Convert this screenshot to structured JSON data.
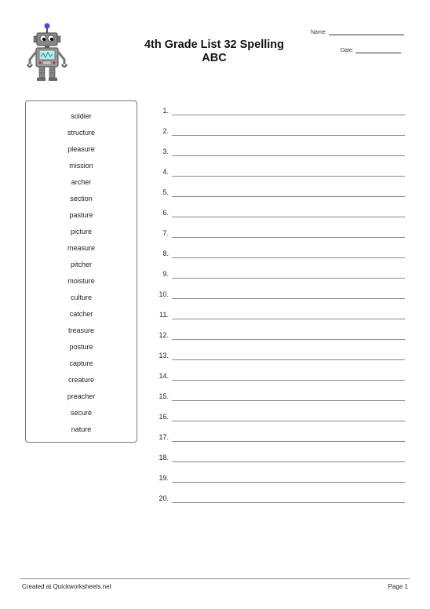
{
  "header": {
    "title_line1": "4th Grade List 32 Spelling",
    "title_line2": "ABC",
    "name_label": "Name:",
    "date_label": "Date:"
  },
  "word_bank": [
    "soldier",
    "structure",
    "pleasure",
    "mission",
    "archer",
    "section",
    "pasture",
    "picture",
    "measure",
    "pitcher",
    "moisture",
    "culture",
    "catcher",
    "treasure",
    "posture",
    "capture",
    "creature",
    "preacher",
    "secure",
    "nature"
  ],
  "answers": [
    "1.",
    "2.",
    "3.",
    "4.",
    "5.",
    "6.",
    "7.",
    "8.",
    "9.",
    "10.",
    "11.",
    "12.",
    "13.",
    "14.",
    "15.",
    "16.",
    "17.",
    "18.",
    "19.",
    "20."
  ],
  "footer": {
    "left": "Created at Quickworksheets.net",
    "right": "Page 1"
  },
  "icons": {
    "logo": "robot-icon"
  },
  "colors": {
    "robot_body": "#8a8a8a",
    "robot_screen": "#bfe8e8",
    "robot_antenna": "#4a4ad0",
    "robot_lights": "#d02020"
  }
}
